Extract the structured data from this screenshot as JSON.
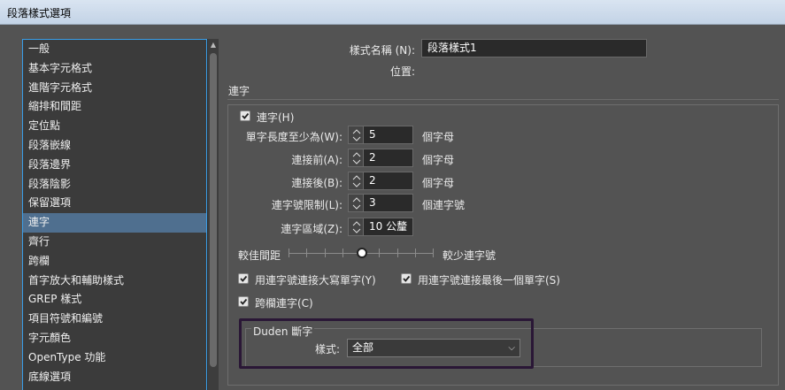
{
  "window": {
    "title": "段落樣式選項"
  },
  "sidebar": {
    "items": [
      {
        "label": "一般"
      },
      {
        "label": "基本字元格式"
      },
      {
        "label": "進階字元格式"
      },
      {
        "label": "縮排和間距"
      },
      {
        "label": "定位點"
      },
      {
        "label": "段落嵌線"
      },
      {
        "label": "段落邊界"
      },
      {
        "label": "段落陰影"
      },
      {
        "label": "保留選項"
      },
      {
        "label": "連字",
        "selected": true
      },
      {
        "label": "齊行"
      },
      {
        "label": "跨欄"
      },
      {
        "label": "首字放大和輔助樣式"
      },
      {
        "label": "GREP 樣式"
      },
      {
        "label": "項目符號和編號"
      },
      {
        "label": "字元顏色"
      },
      {
        "label": "OpenType 功能"
      },
      {
        "label": "底線選項"
      }
    ]
  },
  "header": {
    "style_name_label": "樣式名稱 (N):",
    "style_name_value": "段落樣式1",
    "location_label": "位置:",
    "section_title": "連字"
  },
  "hyphenation": {
    "enable_label": "連字(H)",
    "enable_checked": true,
    "fields": [
      {
        "label": "單字長度至少為(W):",
        "value": "5",
        "unit": "個字母"
      },
      {
        "label": "連接前(A):",
        "value": "2",
        "unit": "個字母"
      },
      {
        "label": "連接後(B):",
        "value": "2",
        "unit": "個字母"
      },
      {
        "label": "連字號限制(L):",
        "value": "3",
        "unit": "個連字號"
      },
      {
        "label": "連字區域(Z):",
        "value": "10 公釐",
        "unit": ""
      }
    ],
    "slider": {
      "left_label": "較佳間距",
      "right_label": "較少連字號",
      "value_fraction": 0.5
    },
    "options": {
      "capitalized": {
        "label": "用連字號連接大寫單字(Y)",
        "checked": true
      },
      "last_word": {
        "label": "用連字號連接最後一個單字(S)",
        "checked": true
      },
      "across_column": {
        "label": "跨欄連字(C)",
        "checked": true
      }
    }
  },
  "duden": {
    "group_title": "Duden 斷字",
    "style_label": "樣式:",
    "style_value": "全部"
  },
  "colors": {
    "background": "#535353",
    "sidebar_bg": "#3b3b3b",
    "selected_item": "#4f6f8f",
    "focus_border": "#3a9ee8",
    "highlight_box": "#2a1736"
  }
}
